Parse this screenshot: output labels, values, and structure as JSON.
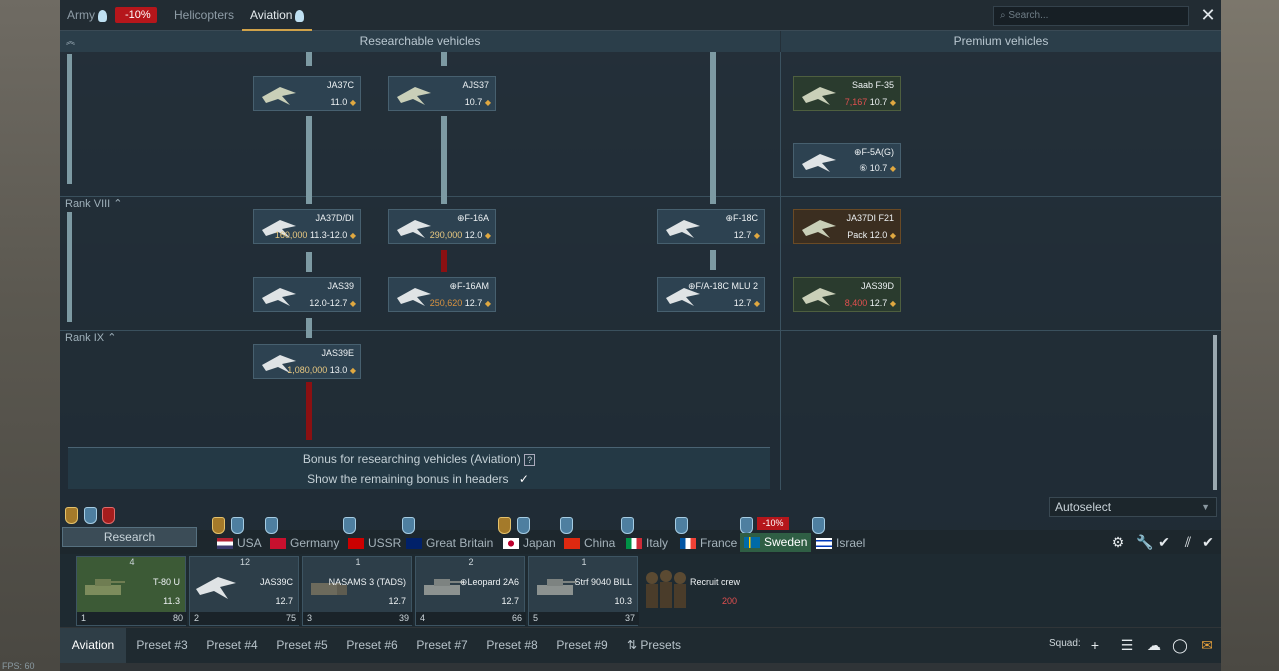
{
  "top_tabs": {
    "army": "Army",
    "army_discount": "-10%",
    "helicopters": "Helicopters",
    "aviation": "Aviation"
  },
  "search": {
    "placeholder": "Search..."
  },
  "sections": {
    "researchable": "Researchable vehicles",
    "premium": "Premium vehicles"
  },
  "ranks": {
    "rank8": "Rank VIII",
    "rank9": "Rank IX"
  },
  "tree_cards": [
    {
      "name": "JA37C",
      "br": "11.0",
      "cost": ""
    },
    {
      "name": "AJS37",
      "br": "10.7",
      "cost": ""
    },
    {
      "name": "JA37D/DI",
      "br": "11.3-12.0",
      "cost": "160,000"
    },
    {
      "name": "⊕F-16A",
      "br": "12.0",
      "cost": "290,000"
    },
    {
      "name": "⊕F-18C",
      "br": "12.7",
      "cost": ""
    },
    {
      "name": "JAS39",
      "br": "12.0-12.7",
      "cost": ""
    },
    {
      "name": "⊕F-16AM",
      "br": "12.7",
      "cost": "250,620"
    },
    {
      "name": "⊕F/A-18C MLU 2",
      "br": "12.7",
      "cost": ""
    },
    {
      "name": "JAS39E",
      "br": "13.0",
      "cost": "1,080,000"
    }
  ],
  "premium_cards": [
    {
      "name": "Saab F-35",
      "br": "10.7",
      "cost": "7,167"
    },
    {
      "name": "⊕F-5A(G)",
      "br": "10.7",
      "cost": "⑥"
    },
    {
      "name": "JA37DI F21",
      "br": "12.0",
      "cost": "Pack"
    },
    {
      "name": "JAS39D",
      "br": "12.7",
      "cost": "8,400"
    }
  ],
  "bonus": {
    "line1": "Bonus for researching vehicles (Aviation)",
    "line2": "Show the remaining bonus in headers",
    "help": "?",
    "check": "✓"
  },
  "autoselect": "Autoselect",
  "research_button": "Research",
  "nations": [
    {
      "name": "USA",
      "colors": [
        "#b22234",
        "#ffffff",
        "#3c3b6e"
      ]
    },
    {
      "name": "Germany",
      "colors": [
        "#c8102e",
        "#ffffff"
      ]
    },
    {
      "name": "USSR",
      "colors": [
        "#cc0000",
        "#ffd700"
      ]
    },
    {
      "name": "Great Britain",
      "colors": [
        "#012169",
        "#c8102e",
        "#ffffff"
      ]
    },
    {
      "name": "Japan",
      "colors": [
        "#ffffff",
        "#bc002d"
      ]
    },
    {
      "name": "China",
      "colors": [
        "#de2910",
        "#ffde00"
      ]
    },
    {
      "name": "Italy",
      "colors": [
        "#009246",
        "#ffffff",
        "#ce2b37"
      ]
    },
    {
      "name": "France",
      "colors": [
        "#0055a4",
        "#ffffff",
        "#ef4135"
      ]
    },
    {
      "name": "Sweden",
      "colors": [
        "#006aa7",
        "#fecc00"
      ]
    },
    {
      "name": "Israel",
      "colors": [
        "#ffffff",
        "#0038b8"
      ]
    }
  ],
  "nation_discount": "-10%",
  "crew_slots": [
    {
      "count": "4",
      "name": "T-80 U",
      "br": "11.3",
      "crew": "1",
      "level": "80"
    },
    {
      "count": "12",
      "name": "JAS39C",
      "br": "12.7",
      "crew": "2",
      "level": "75"
    },
    {
      "count": "1",
      "name": "NASAMS 3 (TADS)",
      "br": "12.7",
      "crew": "3",
      "level": "39"
    },
    {
      "count": "2",
      "name": "⊕Leopard 2A6",
      "br": "12.7",
      "crew": "4",
      "level": "66"
    },
    {
      "count": "1",
      "name": "Strf 9040 BILL",
      "br": "10.3",
      "crew": "5",
      "level": "37"
    }
  ],
  "recruit": {
    "label": "Recruit crew",
    "cost": "200"
  },
  "presets": [
    "Aviation",
    "Preset #3",
    "Preset #4",
    "Preset #5",
    "Preset #6",
    "Preset #7",
    "Preset #8",
    "Preset #9",
    "Presets"
  ],
  "squad_label": "Squad:",
  "fps": "FPS: 60"
}
